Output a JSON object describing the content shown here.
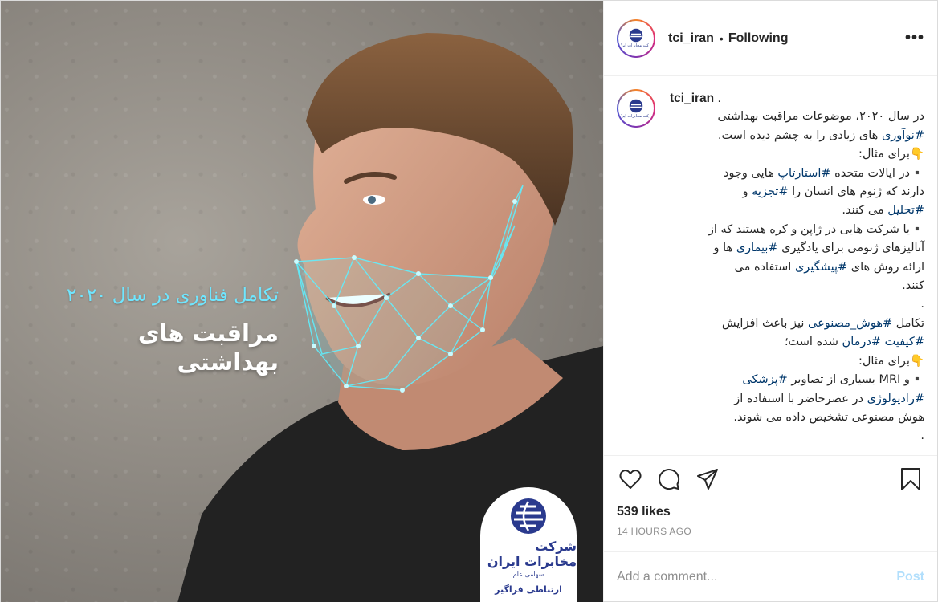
{
  "media": {
    "overlay_line1": "تکامل فناوری در سال ۲۰۲۰",
    "overlay_line2": "مراقبت های بهداشتی",
    "logo_brand": "شرکت مخابرات ایران",
    "logo_sub": "سهامی عام",
    "logo_motto": "ارتباطی فراگیر"
  },
  "header": {
    "username": "tci_iran",
    "separator": "•",
    "follow_status": "Following",
    "more_icon": "more-horizontal-icon"
  },
  "caption": {
    "username": "tci_iran",
    "username_suffix": ".",
    "lines": [
      [
        {
          "t": "در سال ۲۰۲۰، موضوعات مراقبت بهداشتی"
        }
      ],
      [
        {
          "t": "#نوآوری",
          "tag": true
        },
        {
          "t": " های زیادی را به چشم دیده است."
        }
      ],
      [
        {
          "t": "👇برای مثال:"
        }
      ],
      [
        {
          "t": "▪️در ایالات متحده "
        },
        {
          "t": "#استارتاپ",
          "tag": true
        },
        {
          "t": " هایی وجود"
        }
      ],
      [
        {
          "t": "دارند که ژنوم های انسان را "
        },
        {
          "t": "#تجزیه",
          "tag": true
        },
        {
          "t": " و"
        }
      ],
      [
        {
          "t": "#تحلیل",
          "tag": true
        },
        {
          "t": " می کنند."
        }
      ],
      [
        {
          "t": "▪️یا شرکت هایی در ژاپن و کره هستند که از"
        }
      ],
      [
        {
          "t": "آنالیزهای ژنومی برای یادگیری "
        },
        {
          "t": "#بیماری",
          "tag": true
        },
        {
          "t": " ها و"
        }
      ],
      [
        {
          "t": "ارائه روش های "
        },
        {
          "t": "#پیشگیری",
          "tag": true
        },
        {
          "t": " استفاده می"
        }
      ],
      [
        {
          "t": "کنند."
        }
      ],
      [
        {
          "t": "."
        }
      ],
      [
        {
          "t": "تکامل "
        },
        {
          "t": "#هوش_مصنوعی",
          "tag": true
        },
        {
          "t": " نیز باعث افزایش"
        }
      ],
      [
        {
          "t": "#کیفیت",
          "tag": true
        },
        {
          "t": " "
        },
        {
          "t": "#درمان",
          "tag": true
        },
        {
          "t": " شده است؛"
        }
      ],
      [
        {
          "t": "👇برای مثال:"
        }
      ],
      [
        {
          "t": "▪️و MRI بسیاری از تصاویر "
        },
        {
          "t": "#پزشکی",
          "tag": true
        }
      ],
      [
        {
          "t": "#رادیولوژی",
          "tag": true
        },
        {
          "t": " در عصرحاضر با استفاده از"
        }
      ],
      [
        {
          "t": "هوش مصنوعی تشخیص داده می شوند."
        }
      ],
      [
        {
          "t": "."
        }
      ]
    ]
  },
  "actions": {
    "like_icon": "heart-icon",
    "comment_icon": "comment-icon",
    "share_icon": "share-icon",
    "save_icon": "bookmark-icon"
  },
  "likes_text": "539 likes",
  "timestamp": "14 HOURS AGO",
  "add_comment": {
    "placeholder": "Add a comment...",
    "post_label": "Post"
  },
  "colors": {
    "hashtag": "#00376b",
    "post_button": "#b2dffc",
    "overlay_accent": "#6fe6ff",
    "brand_blue": "#2a3a8e"
  }
}
